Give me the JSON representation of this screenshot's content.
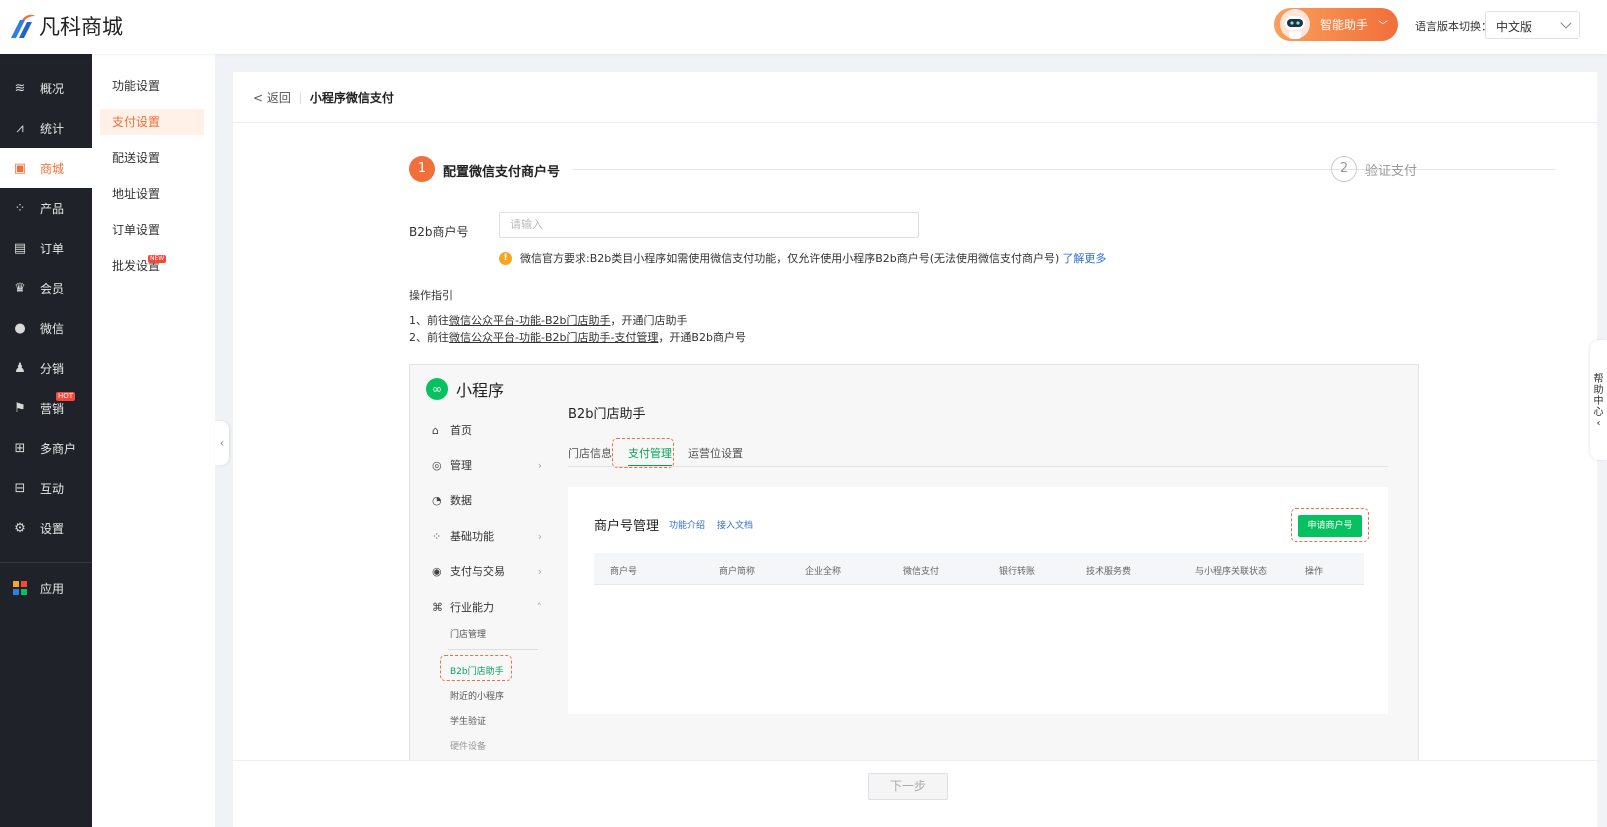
{
  "header": {
    "logo_text": "凡科商城",
    "assistant_label": "智能助手",
    "lang_label": "语言版本切换：",
    "lang_value": "中文版"
  },
  "sidebar": {
    "items": [
      {
        "label": "概况",
        "icon": "layers-icon"
      },
      {
        "label": "统计",
        "icon": "chart-icon"
      },
      {
        "label": "商城",
        "icon": "shop-icon",
        "active": true
      },
      {
        "label": "产品",
        "icon": "grid-icon"
      },
      {
        "label": "订单",
        "icon": "clipboard-icon"
      },
      {
        "label": "会员",
        "icon": "crown-icon"
      },
      {
        "label": "微信",
        "icon": "wechat-icon"
      },
      {
        "label": "分销",
        "icon": "users-icon"
      },
      {
        "label": "营销",
        "icon": "flag-icon",
        "badge": "HOT"
      },
      {
        "label": "多商户",
        "icon": "store-icon"
      },
      {
        "label": "互动",
        "icon": "apps-icon"
      },
      {
        "label": "设置",
        "icon": "gear-icon"
      },
      {
        "label": "应用",
        "icon": "colorful-apps-icon"
      }
    ]
  },
  "subnav": {
    "items": [
      {
        "label": "功能设置"
      },
      {
        "label": "支付设置",
        "active": true
      },
      {
        "label": "配送设置"
      },
      {
        "label": "地址设置"
      },
      {
        "label": "订单设置"
      },
      {
        "label": "批发设置",
        "badge": "NEW"
      }
    ]
  },
  "page": {
    "back_label": "< 返回",
    "title": "小程序微信支付",
    "step1_num": "1",
    "step1_label": "配置微信支付商户号",
    "step2_num": "2",
    "step2_label": "验证支付",
    "field_label": "B2b商户号",
    "field_placeholder": "请输入",
    "notice_text": "微信官方要求:B2b类目小程序如需使用微信支付功能，仅允许使用小程序B2b商户号(无法使用微信支付商户号)",
    "notice_link": "了解更多",
    "guide_title": "操作指引",
    "guide1_prefix": "1、前往",
    "guide1_link": "微信公众平台-功能-B2b门店助手",
    "guide1_suffix": "，开通门店助手",
    "guide2_prefix": "2、前往",
    "guide2_link": "微信公众平台-功能-B2b门店助手-支付管理",
    "guide2_suffix": "，开通B2b商户号",
    "next_button": "下一步",
    "help_text": "帮助中心"
  },
  "screenshot": {
    "brand": "小程序",
    "nav": [
      {
        "label": "首页",
        "icon": "home-icon"
      },
      {
        "label": "管理",
        "icon": "settings-icon",
        "arrow": ">"
      },
      {
        "label": "数据",
        "icon": "pie-icon"
      },
      {
        "label": "基础功能",
        "icon": "modules-icon",
        "arrow": ">"
      },
      {
        "label": "支付与交易",
        "icon": "pay-icon",
        "arrow": ">"
      },
      {
        "label": "行业能力",
        "icon": "industry-icon",
        "arrow": "^"
      }
    ],
    "sub_items": [
      "门店管理",
      "B2b门店助手",
      "附近的小程序",
      "学生验证",
      "硬件设备"
    ],
    "section_title": "B2b门店助手",
    "tabs": [
      "门店信息",
      "支付管理",
      "运营位设置"
    ],
    "panel_title": "商户号管理",
    "panel_link1": "功能介绍",
    "panel_link2": "接入文档",
    "apply_button": "申请商户号",
    "columns": [
      "商户号",
      "商户简称",
      "企业全称",
      "微信支付",
      "银行转账",
      "技术服务费",
      "与小程序关联状态",
      "操作"
    ]
  }
}
